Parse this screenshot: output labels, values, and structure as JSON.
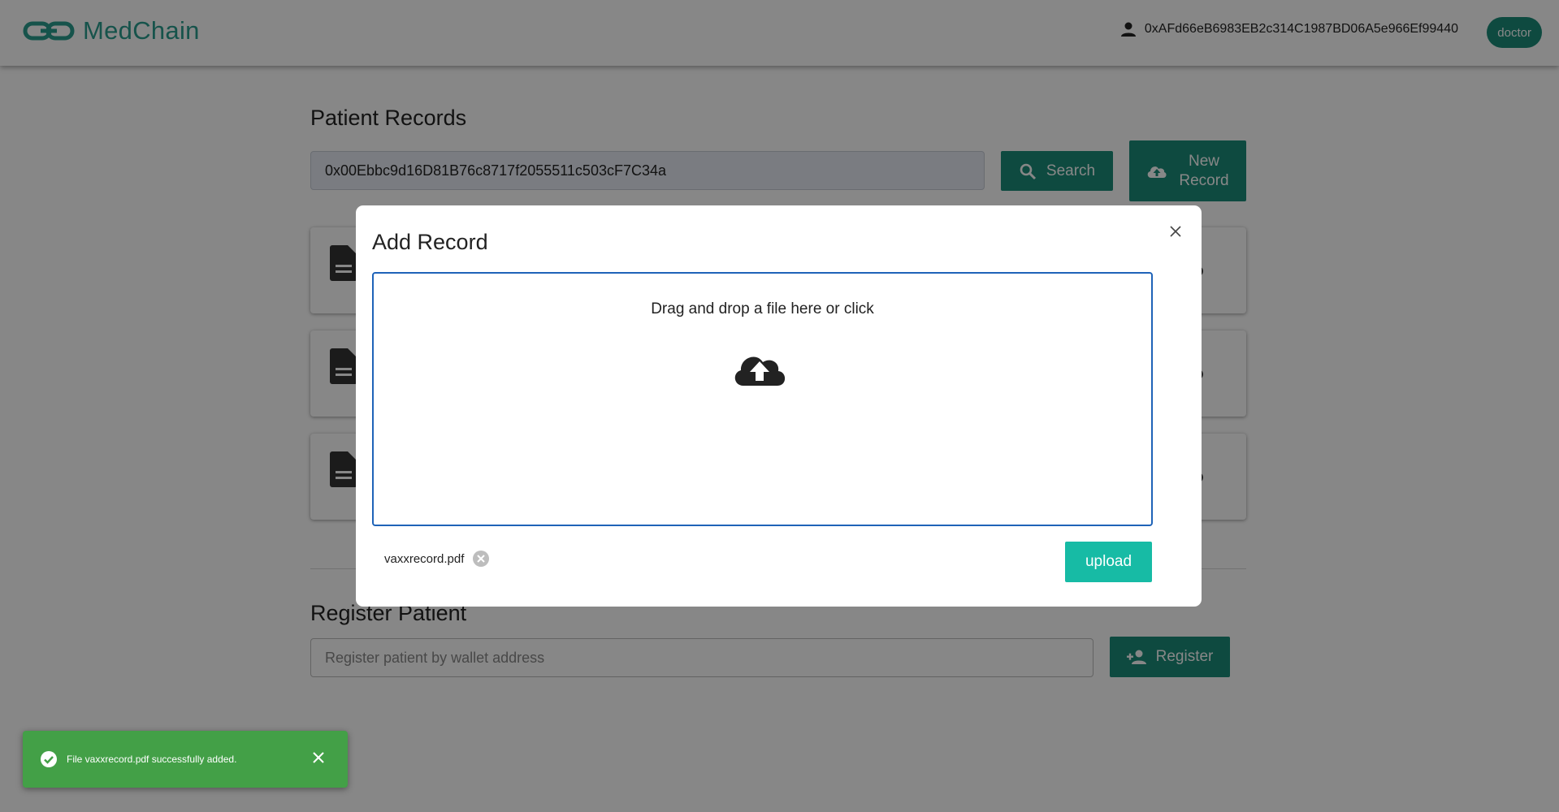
{
  "header": {
    "app_name": "MedChain",
    "account_address": "0xAFd66eB6983EB2c314C1987BD06A5e966Ef99440",
    "role": "doctor"
  },
  "records": {
    "title": "Patient Records",
    "search_value": "0x00Ebbc9d16D81B76c8717f2055511c503cF7C34a",
    "search_label": "Search",
    "new_record_line1": "New",
    "new_record_line2": "Record"
  },
  "register": {
    "title": "Register Patient",
    "placeholder": "Register patient by wallet address",
    "button_label": "Register"
  },
  "modal": {
    "title": "Add Record",
    "dropzone_text": "Drag and drop a file here or click",
    "file_name": "vaxxrecord.pdf",
    "upload_label": "upload"
  },
  "toast": {
    "message": "File vaxxrecord.pdf successfully added."
  },
  "colors": {
    "brand": "#2a9d8f",
    "primary_button": "#1b8c7a",
    "upload_button": "#17bba5",
    "dropzone_border": "#1f63b8",
    "success_toast": "#43a047"
  },
  "icons": [
    "chain-link-icon",
    "account-icon",
    "search-icon",
    "cloud-upload-icon",
    "document-icon",
    "close-icon",
    "remove-file-icon",
    "check-circle-icon",
    "add-user-icon"
  ]
}
